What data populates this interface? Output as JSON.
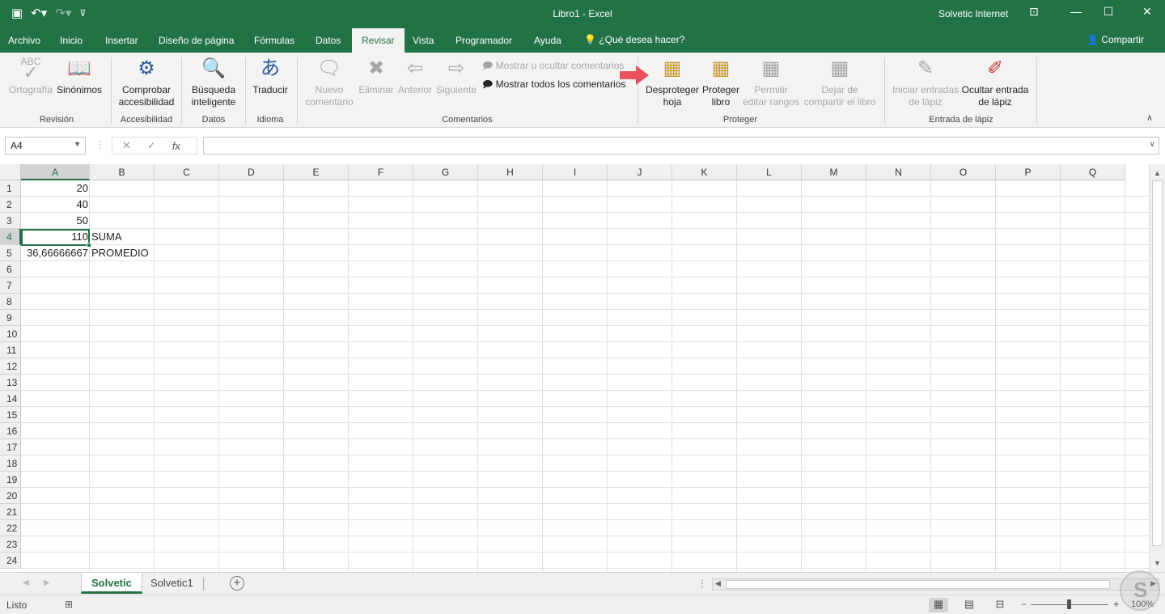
{
  "window": {
    "title": "Libro1  -  Excel",
    "user": "Solvetic Internet"
  },
  "tabs": [
    {
      "label": "Archivo"
    },
    {
      "label": "Inicio"
    },
    {
      "label": "Insertar"
    },
    {
      "label": "Diseño de página"
    },
    {
      "label": "Fórmulas"
    },
    {
      "label": "Datos"
    },
    {
      "label": "Revisar"
    },
    {
      "label": "Vista"
    },
    {
      "label": "Programador"
    },
    {
      "label": "Ayuda"
    }
  ],
  "active_tab": "Revisar",
  "tell_me": "¿Qué desea hacer?",
  "share": "Compartir",
  "ribbon": {
    "revision": {
      "group": "Revisión",
      "spelling_abc": "ABC",
      "spelling": "Ortografía",
      "thesaurus": "Sinónimos"
    },
    "accessibility": {
      "group": "Accesibilidad",
      "check_line1": "Comprobar",
      "check_line2": "accesibilidad"
    },
    "data": {
      "group": "Datos",
      "smart_line1": "Búsqueda",
      "smart_line2": "inteligente"
    },
    "language": {
      "group": "Idioma",
      "translate": "Traducir"
    },
    "comments": {
      "group": "Comentarios",
      "new_line1": "Nuevo",
      "new_line2": "comentario",
      "delete": "Eliminar",
      "previous": "Anterior",
      "next": "Siguiente",
      "show_hide": "Mostrar u ocultar comentarios",
      "show_all": "Mostrar todos los comentarios"
    },
    "protect": {
      "group": "Proteger",
      "unprotect_line1": "Desproteger",
      "unprotect_line2": "hoja",
      "protect_book_line1": "Proteger",
      "protect_book_line2": "libro",
      "allow_line1": "Permitir",
      "allow_line2": "editar rangos",
      "unshare_line1": "Dejar de",
      "unshare_line2": "compartir el libro"
    },
    "ink": {
      "group": "Entrada de lápiz",
      "start_line1": "Iniciar entradas",
      "start_line2": "de lápiz",
      "hide_line1": "Ocultar entrada",
      "hide_line2": "de lápiz"
    }
  },
  "formula_bar": {
    "name_box": "A4",
    "fx": "fx",
    "value": ""
  },
  "columns": [
    "A",
    "B",
    "C",
    "D",
    "E",
    "F",
    "G",
    "H",
    "I",
    "J",
    "K",
    "L",
    "M",
    "N",
    "O",
    "P",
    "Q"
  ],
  "rows": [
    "1",
    "2",
    "3",
    "4",
    "5",
    "6",
    "7",
    "8",
    "9",
    "10",
    "11",
    "12",
    "13",
    "14",
    "15",
    "16",
    "17",
    "18",
    "19",
    "20",
    "21",
    "22",
    "23",
    "24"
  ],
  "cells": {
    "A1": "20",
    "A2": "40",
    "A3": "50",
    "A4": "110",
    "B4": "SUMA",
    "A5": "36,66666667",
    "B5": "PROMEDIO"
  },
  "selected_cell": "A4",
  "sheets": [
    {
      "label": "Solvetic",
      "active": true
    },
    {
      "label": "Solvetic1",
      "active": false
    }
  ],
  "status": {
    "ready": "Listo",
    "zoom": "100%"
  },
  "colors": {
    "brand": "#217346",
    "arrow": "#e8515d"
  }
}
